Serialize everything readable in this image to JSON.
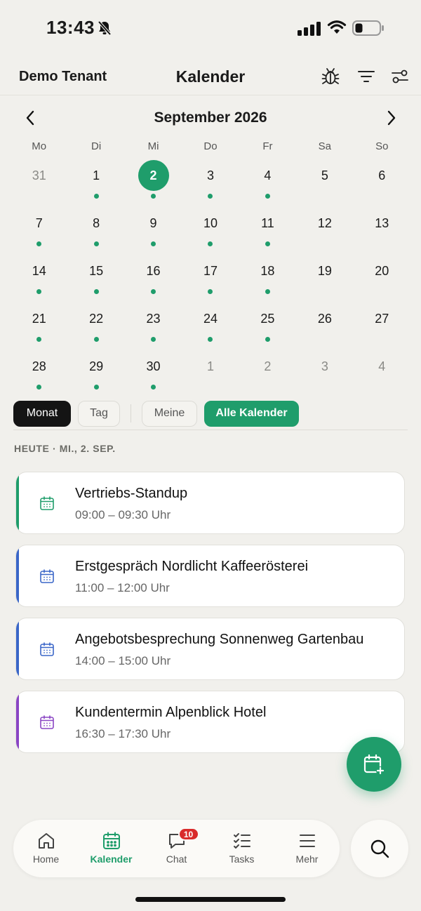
{
  "status_bar": {
    "time": "13:43"
  },
  "header": {
    "tenant": "Demo Tenant",
    "title": "Kalender",
    "icons": [
      "bug-icon",
      "filter-icon",
      "sliders-icon"
    ]
  },
  "month_nav": {
    "label": "September 2026"
  },
  "weekdays": [
    "Mo",
    "Di",
    "Mi",
    "Do",
    "Fr",
    "Sa",
    "So"
  ],
  "days": [
    {
      "label": "31",
      "muted": true,
      "dot": false
    },
    {
      "label": "1",
      "dot": true
    },
    {
      "label": "2",
      "dot": true,
      "today": true
    },
    {
      "label": "3",
      "dot": true
    },
    {
      "label": "4",
      "dot": true
    },
    {
      "label": "5",
      "dot": false
    },
    {
      "label": "6",
      "dot": false
    },
    {
      "label": "7",
      "dot": true
    },
    {
      "label": "8",
      "dot": true
    },
    {
      "label": "9",
      "dot": true
    },
    {
      "label": "10",
      "dot": true
    },
    {
      "label": "11",
      "dot": true
    },
    {
      "label": "12",
      "dot": false
    },
    {
      "label": "13",
      "dot": false
    },
    {
      "label": "14",
      "dot": true
    },
    {
      "label": "15",
      "dot": true
    },
    {
      "label": "16",
      "dot": true
    },
    {
      "label": "17",
      "dot": true
    },
    {
      "label": "18",
      "dot": true
    },
    {
      "label": "19",
      "dot": false
    },
    {
      "label": "20",
      "dot": false
    },
    {
      "label": "21",
      "dot": true
    },
    {
      "label": "22",
      "dot": true
    },
    {
      "label": "23",
      "dot": true
    },
    {
      "label": "24",
      "dot": true
    },
    {
      "label": "25",
      "dot": true
    },
    {
      "label": "26",
      "dot": false
    },
    {
      "label": "27",
      "dot": false
    },
    {
      "label": "28",
      "dot": true
    },
    {
      "label": "29",
      "dot": true
    },
    {
      "label": "30",
      "dot": true
    },
    {
      "label": "1",
      "muted": true,
      "dot": false
    },
    {
      "label": "2",
      "muted": true,
      "dot": false
    },
    {
      "label": "3",
      "muted": true,
      "dot": false
    },
    {
      "label": "4",
      "muted": true,
      "dot": false
    }
  ],
  "chips": {
    "monat": "Monat",
    "tag": "Tag",
    "meine": "Meine",
    "alle": "Alle Kalender"
  },
  "today_heading": "HEUTE · MI., 2. SEP.",
  "events": [
    {
      "title": "Vertriebs-Standup",
      "time": "09:00 – 09:30 Uhr",
      "color": "#1f9d6b"
    },
    {
      "title": "Erstgespräch Nordlicht Kaffeerösterei",
      "time": "11:00 – 12:00 Uhr",
      "color": "#3a66c8"
    },
    {
      "title": "Angebotsbesprechung Sonnenweg Gartenbau",
      "time": "14:00 – 15:00 Uhr",
      "color": "#3a66c8"
    },
    {
      "title": "Kundentermin Alpenblick Hotel",
      "time": "16:30 – 17:30 Uhr",
      "color": "#8a45c4"
    }
  ],
  "bottom_nav": {
    "home": "Home",
    "kalender": "Kalender",
    "chat": "Chat",
    "chat_badge": "10",
    "tasks": "Tasks",
    "mehr": "Mehr"
  },
  "colors": {
    "accent": "#1f9d6b",
    "background": "#f1f0ec",
    "badge": "#d92b2b"
  }
}
